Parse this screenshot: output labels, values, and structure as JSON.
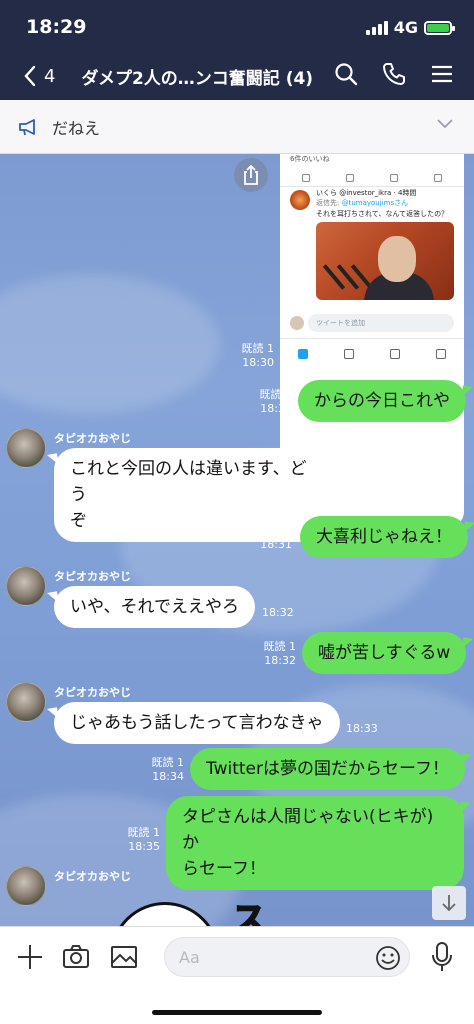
{
  "status": {
    "time": "18:29",
    "network": "4G"
  },
  "header": {
    "back_count": "4",
    "title": "ダメプ2人の…ンコ奮闘記 (4)"
  },
  "announcement": {
    "text": "だねえ"
  },
  "tweet": {
    "likes": "6件のいいね",
    "name": "いくら @investor_ikra · 4時間",
    "reply_prefix": "返信先:",
    "reply_handle": "@tumayoujimsさん",
    "body": "それを耳打ちされて、なんて返答したの？",
    "reply_placeholder": "ツイートを追加"
  },
  "messages": [
    {
      "side": "right",
      "read": "既読 1",
      "time": "18:30",
      "text": ""
    },
    {
      "side": "right",
      "read": "既読 1",
      "time": "18:30",
      "text": "からの今日これや"
    },
    {
      "side": "left",
      "sender": "タピオカおやじ",
      "time": "18:31",
      "line1": "これと今回の人は違います、どう",
      "line2": "ぞ"
    },
    {
      "side": "right",
      "read": "既読 1",
      "time": "18:31",
      "text": "大喜利じゃねえ！"
    },
    {
      "side": "left",
      "sender": "タピオカおやじ",
      "time": "18:32",
      "text": "いや、それでええやろ"
    },
    {
      "side": "right",
      "read": "既読 1",
      "time": "18:32",
      "text": "嘘が苦しすぐるw"
    },
    {
      "side": "left",
      "sender": "タピオカおやじ",
      "time": "18:33",
      "text": "じゃあもう話したって言わなきゃ"
    },
    {
      "side": "right",
      "read": "既読 1",
      "time": "18:34",
      "text": "Twitterは夢の国だからセーフ！"
    },
    {
      "side": "right",
      "read": "既読 1",
      "time": "18:35",
      "line1": "タピさんは人間じゃない(ヒキが)か",
      "line2": "らセーフ！"
    },
    {
      "side": "left",
      "sender": "タピオカおやじ",
      "sticker_text": "ス"
    }
  ],
  "input": {
    "placeholder": "Aa"
  },
  "colors": {
    "header_bg": "#232b47",
    "bubble_green": "#66e05b",
    "chat_bg": "#7d9bd1"
  }
}
